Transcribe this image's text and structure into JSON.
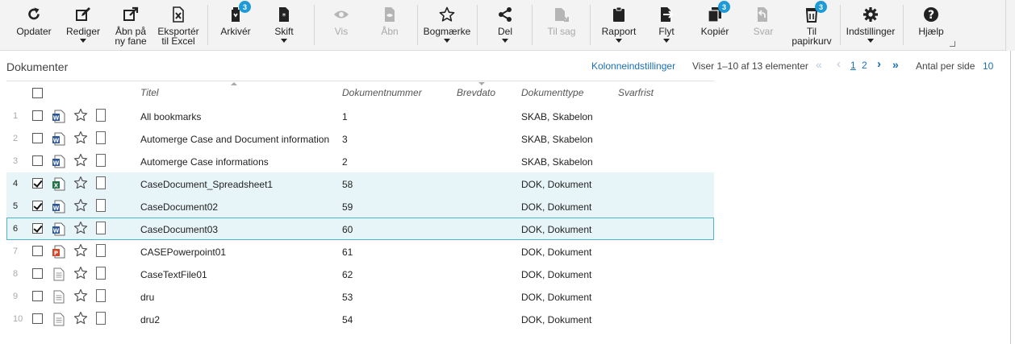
{
  "toolbar": {
    "buttons": [
      {
        "label": "Opdater",
        "icon": "refresh-icon"
      },
      {
        "label": "Rediger",
        "icon": "edit-icon"
      },
      {
        "label": "Åbn på\nny fane",
        "icon": "external-link-icon"
      },
      {
        "label": "Eksportér\ntil Excel",
        "icon": "excel-icon"
      },
      {
        "label": "Arkivér",
        "icon": "archive-icon",
        "badge": "3"
      },
      {
        "label": "Skift",
        "icon": "document-switch-icon"
      },
      {
        "label": "Vis",
        "icon": "eye-icon"
      },
      {
        "label": "Åbn",
        "icon": "open-file-icon"
      },
      {
        "label": "Bogmærke",
        "icon": "star-icon"
      },
      {
        "label": "Del",
        "icon": "share-icon"
      },
      {
        "label": "Til sag",
        "icon": "move-to-case-icon"
      },
      {
        "label": "Rapport",
        "icon": "clipboard-icon"
      },
      {
        "label": "Flyt",
        "icon": "move-icon"
      },
      {
        "label": "Kopiér",
        "icon": "copy-icon",
        "badge": "3"
      },
      {
        "label": "Svar",
        "icon": "reply-icon"
      },
      {
        "label": "Til\npapirkurv",
        "icon": "recycle-bin-icon",
        "badge": "3"
      },
      {
        "label": "Indstillinger",
        "icon": "gear-icon"
      },
      {
        "label": "Hjælp",
        "icon": "help-icon"
      }
    ]
  },
  "list": {
    "title": "Dokumenter",
    "column_settings": "Kolonneindstillinger",
    "showing": "Viser 1–10 af 13 elementer",
    "pager": {
      "first": "«",
      "prev": "‹",
      "pages": [
        "1",
        "2"
      ],
      "next": "›",
      "last": "»"
    },
    "per_page_label": "Antal per side",
    "per_page_value": "10"
  },
  "columns": {
    "title": "Titel",
    "docnum": "Dokumentnummer",
    "letterdate": "Brevdato",
    "doctype": "Dokumenttype",
    "deadline": "Svarfrist"
  },
  "rows": [
    {
      "n": "1",
      "title": "All bookmarks",
      "docnum": "1",
      "doctype": "SKAB, Skabelon",
      "filetype": "word-icon",
      "checked": false,
      "state": ""
    },
    {
      "n": "2",
      "title": "Automerge Case and Document information",
      "docnum": "3",
      "doctype": "SKAB, Skabelon",
      "filetype": "word-icon",
      "checked": false,
      "state": ""
    },
    {
      "n": "3",
      "title": "Automerge Case informations",
      "docnum": "2",
      "doctype": "SKAB, Skabelon",
      "filetype": "word-icon",
      "checked": false,
      "state": ""
    },
    {
      "n": "4",
      "title": "CaseDocument_Spreadsheet1",
      "docnum": "58",
      "doctype": "DOK, Dokument",
      "filetype": "excel-icon",
      "checked": true,
      "state": "selected"
    },
    {
      "n": "5",
      "title": "CaseDocument02",
      "docnum": "59",
      "doctype": "DOK, Dokument",
      "filetype": "word-icon",
      "checked": true,
      "state": "selected"
    },
    {
      "n": "6",
      "title": "CaseDocument03",
      "docnum": "60",
      "doctype": "DOK, Dokument",
      "filetype": "word-icon",
      "checked": true,
      "state": "focused"
    },
    {
      "n": "7",
      "title": "CASEPowerpoint01",
      "docnum": "61",
      "doctype": "DOK, Dokument",
      "filetype": "powerpoint-icon",
      "checked": false,
      "state": ""
    },
    {
      "n": "8",
      "title": "CaseTextFile01",
      "docnum": "62",
      "doctype": "DOK, Dokument",
      "filetype": "text-file-icon",
      "checked": false,
      "state": ""
    },
    {
      "n": "9",
      "title": "dru",
      "docnum": "53",
      "doctype": "DOK, Dokument",
      "filetype": "text-file-icon",
      "checked": false,
      "state": ""
    },
    {
      "n": "10",
      "title": "dru2",
      "docnum": "54",
      "doctype": "DOK, Dokument",
      "filetype": "text-file-icon",
      "checked": false,
      "state": ""
    }
  ],
  "colors": {
    "accent": "#1a6fb5",
    "badge": "#1e9bd7",
    "selected_row": "#e8f5f8",
    "focus_border": "#4fb3cc"
  }
}
